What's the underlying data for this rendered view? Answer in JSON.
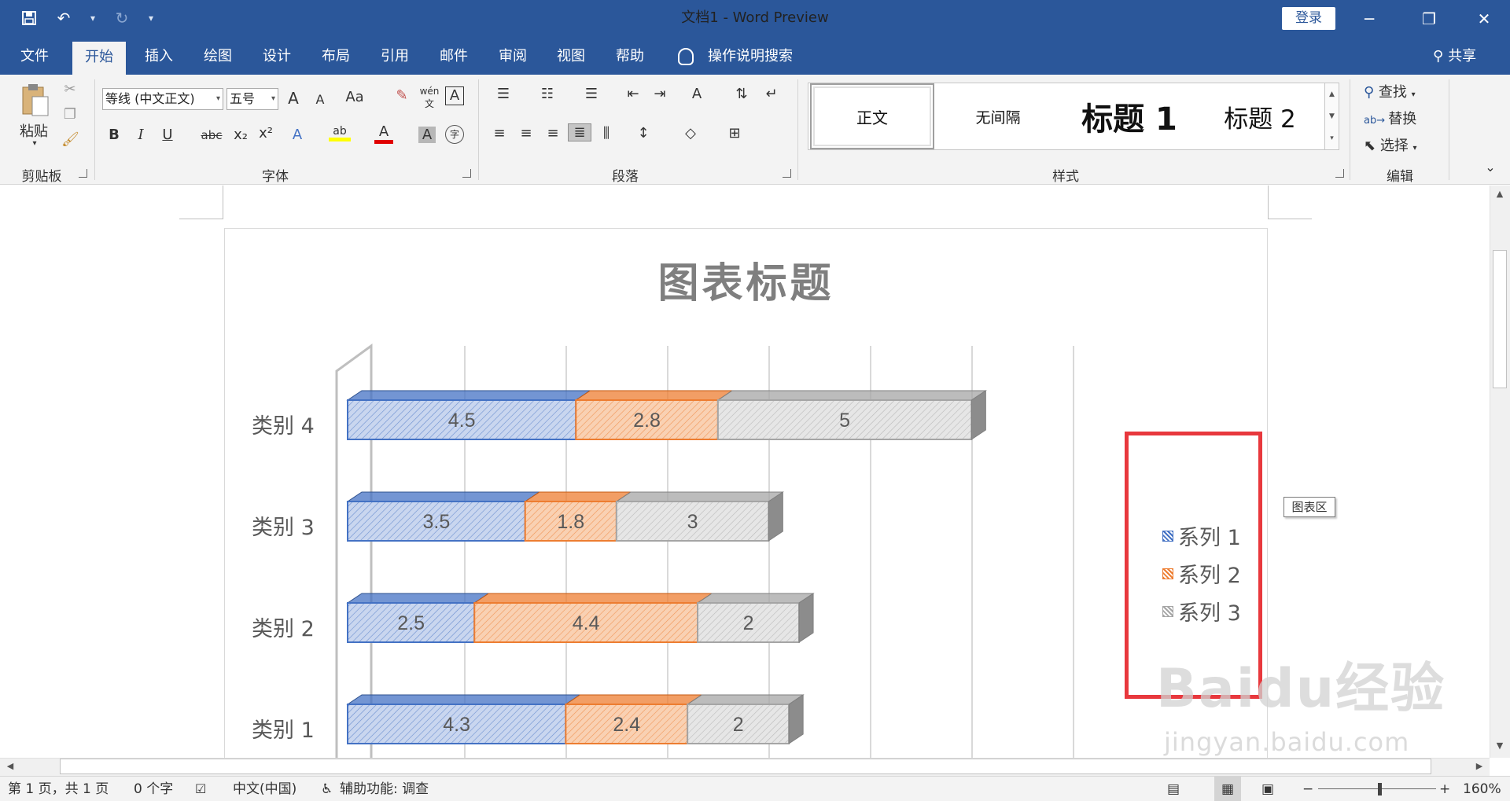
{
  "window": {
    "title": "文档1 - Word Preview",
    "login_label": "登录",
    "controls": {
      "minimize": "─",
      "restore": "❐",
      "close": "✕"
    },
    "accent_color": "#2b579a"
  },
  "quick_access": {
    "save_icon": "save-icon",
    "undo_icon": "undo-icon",
    "redo_icon": "redo-icon",
    "customize_icon": "customize-icon"
  },
  "ribbon_tabs": {
    "items": [
      {
        "label": "文件"
      },
      {
        "label": "开始",
        "active": true
      },
      {
        "label": "插入"
      },
      {
        "label": "绘图"
      },
      {
        "label": "设计"
      },
      {
        "label": "布局"
      },
      {
        "label": "引用"
      },
      {
        "label": "邮件"
      },
      {
        "label": "审阅"
      },
      {
        "label": "视图"
      },
      {
        "label": "帮助"
      }
    ],
    "tell_me": "操作说明搜索",
    "share": "共享"
  },
  "ribbon": {
    "clipboard": {
      "paste_label": "粘贴",
      "group_label": "剪贴板"
    },
    "font": {
      "group_label": "字体",
      "font_name": "等线 (中文正文)",
      "font_size": "五号",
      "grow": "A",
      "shrink": "A",
      "case": "Aa",
      "bold": "B",
      "italic": "I",
      "underline": "U",
      "strike": "abc",
      "subscript": "x₂",
      "superscript": "x²",
      "text_effect": "A",
      "highlight": "ab",
      "font_color": "A",
      "shade": "A",
      "phonetic": "wén文",
      "border_char": "A",
      "enclose": "字"
    },
    "paragraph": {
      "group_label": "段落"
    },
    "styles": {
      "group_label": "样式",
      "items": [
        "正文",
        "无间隔",
        "标题 1",
        "标题 2"
      ]
    },
    "editing": {
      "group_label": "编辑",
      "find": "查找",
      "replace": "替换",
      "select": "选择"
    }
  },
  "chart_data": {
    "type": "bar",
    "orientation": "horizontal",
    "stacked": true,
    "three_d": true,
    "title": "图表标题",
    "categories": [
      "类别 1",
      "类别 2",
      "类别 3",
      "类别 4"
    ],
    "series": [
      {
        "name": "系列 1",
        "values": [
          4.3,
          2.5,
          3.5,
          4.5
        ],
        "color": "#4472c4"
      },
      {
        "name": "系列 2",
        "values": [
          2.4,
          4.4,
          1.8,
          2.8
        ],
        "color": "#ed7d31"
      },
      {
        "name": "系列 3",
        "values": [
          2,
          2,
          3,
          5
        ],
        "color": "#a5a5a5"
      }
    ],
    "xlim": [
      0,
      14
    ],
    "grid": true,
    "legend_position": "right",
    "data_labels": true
  },
  "chart_tooltip": "图表区",
  "watermark": {
    "main": "Baidu经验",
    "sub": "jingyan.baidu.com"
  },
  "statusbar": {
    "page": "第 1 页，共 1 页",
    "words": "0 个字",
    "language": "中文(中国)",
    "accessibility": "辅助功能: 调查",
    "zoom": "160%"
  }
}
